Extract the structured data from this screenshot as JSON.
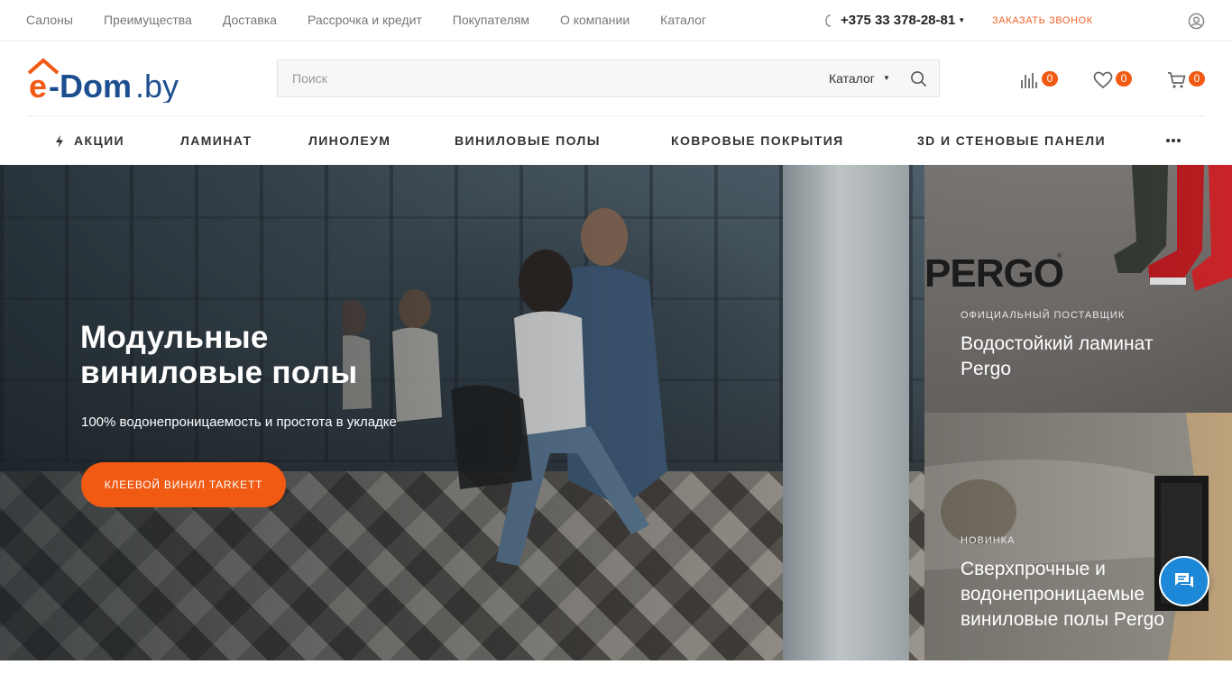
{
  "top_nav": {
    "links": [
      "Салоны",
      "Преимущества",
      "Доставка",
      "Рассрочка и кредит",
      "Покупателям",
      "О компании",
      "Каталог"
    ],
    "phone": "+375 33 378-28-81",
    "callback_label": "Заказать звонок"
  },
  "logo": {
    "text_prefix": "e-Dom",
    "text_suffix": ".by",
    "brand_color": "#1d4e8f",
    "accent_color": "#f05a12"
  },
  "search": {
    "placeholder": "Поиск",
    "value": "",
    "category_label": "Каталог"
  },
  "header_counters": {
    "compare": "0",
    "wishlist": "0",
    "cart": "0"
  },
  "main_nav": [
    "Акции",
    "Ламинат",
    "Линолеум",
    "Виниловые полы",
    "Ковровые покрытия",
    "3D и стеновые панели"
  ],
  "hero": {
    "title_line1": "Модульные",
    "title_line2": "виниловые полы",
    "subtitle": "100% водонепроницаемость и простота в укладке",
    "button_label": "Клеевой винил Tarkett"
  },
  "banners": [
    {
      "logo_text": "PERGO",
      "kicker": "Официальный поставщик",
      "title_line1": "Водостойкий ламинат",
      "title_line2": "Pergo"
    },
    {
      "kicker": "Новинка",
      "title_line1": "Сверхпрочные и",
      "title_line2": "водонепроницаемые",
      "title_line3": "виниловые полы Pergo"
    }
  ],
  "colors": {
    "accent": "#f05a12",
    "chat": "#1e88d8",
    "text_muted": "#777777"
  },
  "icons": [
    "phone-icon",
    "user-icon",
    "search-icon",
    "compare-icon",
    "heart-icon",
    "cart-icon",
    "bolt-icon",
    "more-icon",
    "chat-icon"
  ]
}
